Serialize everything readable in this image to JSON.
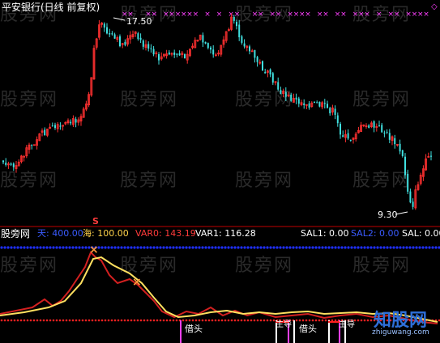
{
  "main_chart": {
    "title": "平安银行(日线 前复权)",
    "high_label": "17.50",
    "low_label": "9.30"
  },
  "indicator_bar": {
    "name": "股旁网",
    "items": [
      {
        "label": "天",
        "value": "400.00",
        "color": "#3a5bff"
      },
      {
        "label": "海",
        "value": "100.00",
        "color": "#ffd24a"
      },
      {
        "label": "VAR0",
        "value": "143.19",
        "color": "#ff3b3b"
      },
      {
        "label": "VAR1",
        "value": "116.28",
        "color": "#ffffff"
      },
      {
        "label": "SAL1",
        "value": "0.00",
        "color": "#ffffff"
      },
      {
        "label": "SAL2",
        "value": "0.00",
        "color": "#3a5bff"
      },
      {
        "label": "SAL",
        "value": "0.00",
        "color": "#ffffff"
      }
    ],
    "marker_s": "S"
  },
  "signals": [
    "借头",
    "借头",
    "主导",
    "主导"
  ],
  "watermark": "股旁网",
  "logo": {
    "text": "知股网",
    "url": "zhiguwang.com"
  },
  "colors": {
    "up": "#ff3030",
    "down": "#40e0e0",
    "indicator_red": "#d22020",
    "indicator_yellow": "#ffe060",
    "blue_line": "#2030ff",
    "magenta": "#ff40ff"
  }
}
